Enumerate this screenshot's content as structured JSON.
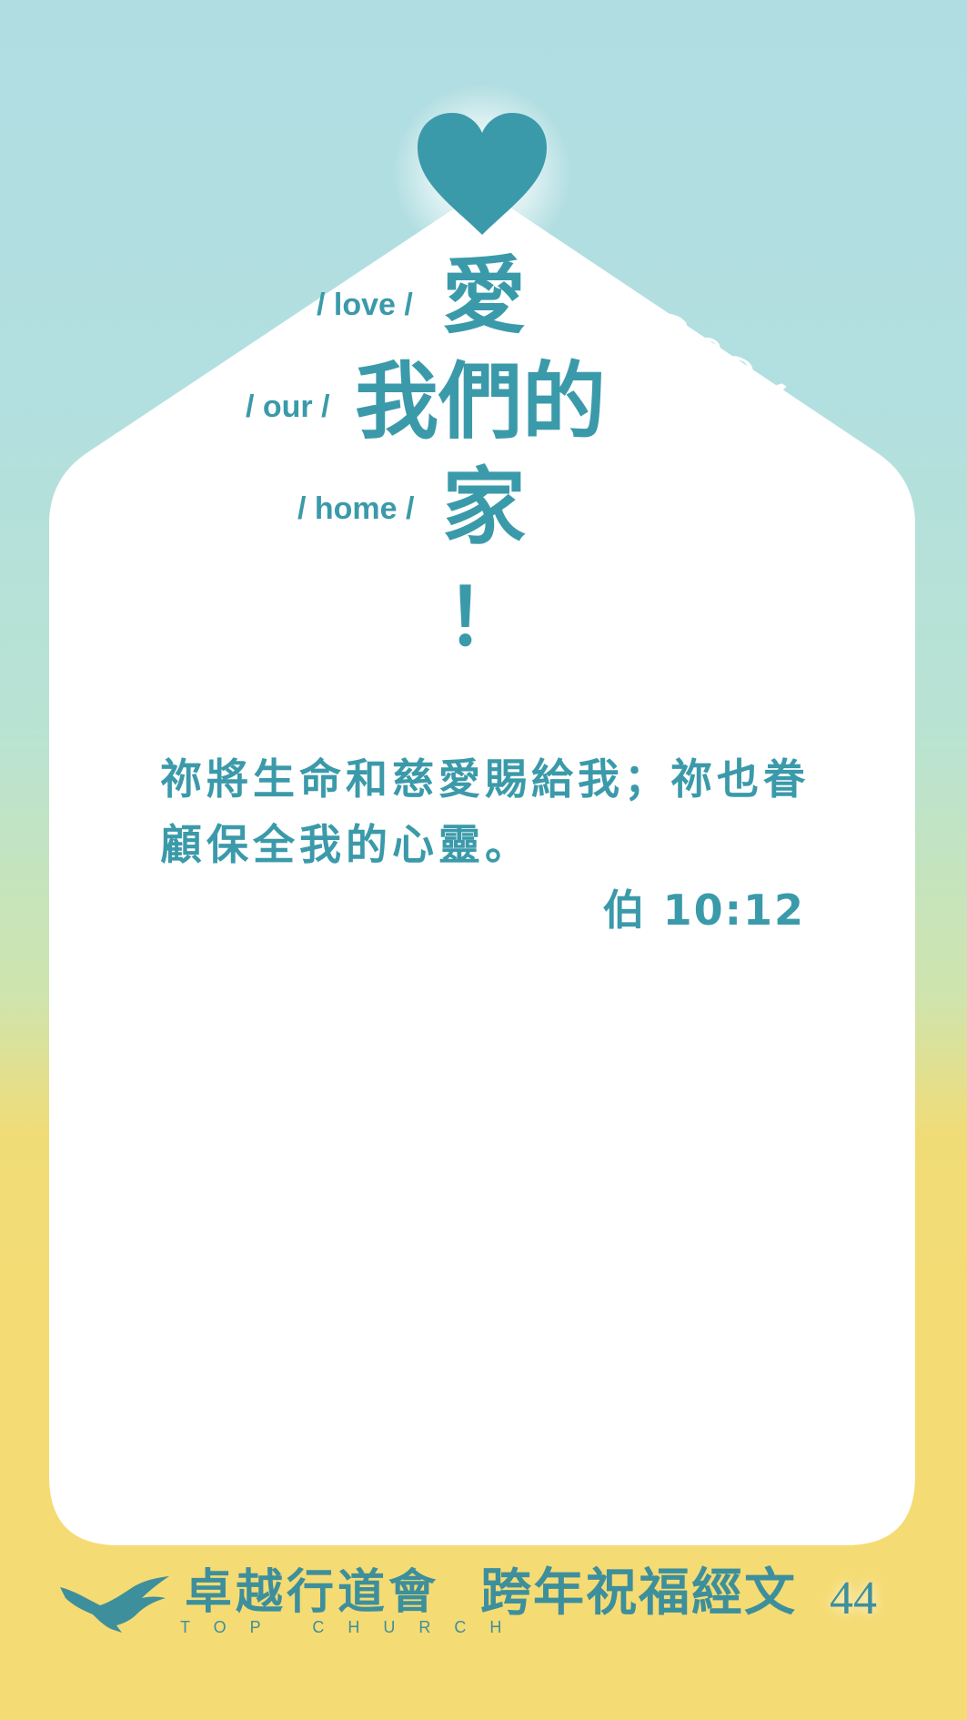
{
  "year": "2024",
  "title": {
    "lines": [
      {
        "english": "/ love /",
        "chinese": "愛"
      },
      {
        "english": "/ our /",
        "chinese": "我們的"
      },
      {
        "english": "/ home /",
        "chinese": "家"
      }
    ],
    "exclamation": "！"
  },
  "verse": {
    "text": "祢將生命和慈愛賜給我；祢也眷顧保全我的心靈。",
    "reference": "伯 10:12"
  },
  "footer": {
    "church_name": "卓越行道會",
    "church_name_en": "TOP CHURCH",
    "subtitle": "跨年祝福經文",
    "page_number": "44",
    "logo_icon": "eagle-icon"
  },
  "colors": {
    "accent": "#3b9aaa",
    "sky": "#b0dde2",
    "sand": "#f5db73",
    "card": "#ffffff"
  }
}
